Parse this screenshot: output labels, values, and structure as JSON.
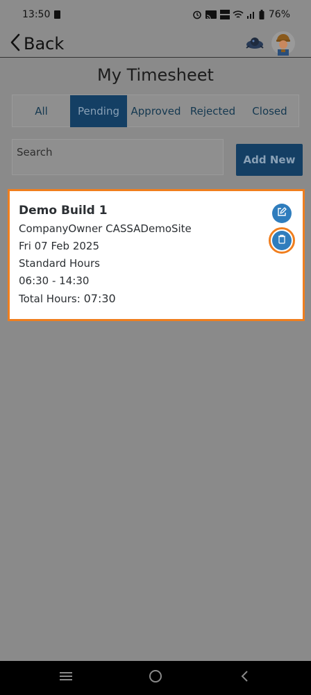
{
  "status_bar": {
    "time": "13:50",
    "battery": "76%"
  },
  "header": {
    "back_label": "Back"
  },
  "page": {
    "title": "My Timesheet"
  },
  "tabs": [
    {
      "label": "All",
      "active": false
    },
    {
      "label": "Pending",
      "active": true
    },
    {
      "label": "Approved",
      "active": false
    },
    {
      "label": "Rejected",
      "active": false
    },
    {
      "label": "Closed",
      "active": false
    }
  ],
  "search": {
    "placeholder": "Search"
  },
  "actions": {
    "add_new_label": "Add New"
  },
  "timesheets": [
    {
      "title": "Demo Build 1",
      "company_site": "CompanyOwner CASSADemoSite",
      "date": "Fri 07 Feb 2025",
      "hours_type": "Standard Hours",
      "time_range": "06:30 - 14:30",
      "total_hours_label": "Total Hours:",
      "total_hours_value": "07:30"
    }
  ],
  "colors": {
    "accent": "#143f64",
    "button_blue": "#2f7dbd",
    "highlight": "#f07e1e",
    "overlay_bg": "#8c8c8c"
  },
  "icons": {
    "edit": "edit-icon",
    "delete": "trash-icon",
    "back": "chevron-left-icon"
  }
}
